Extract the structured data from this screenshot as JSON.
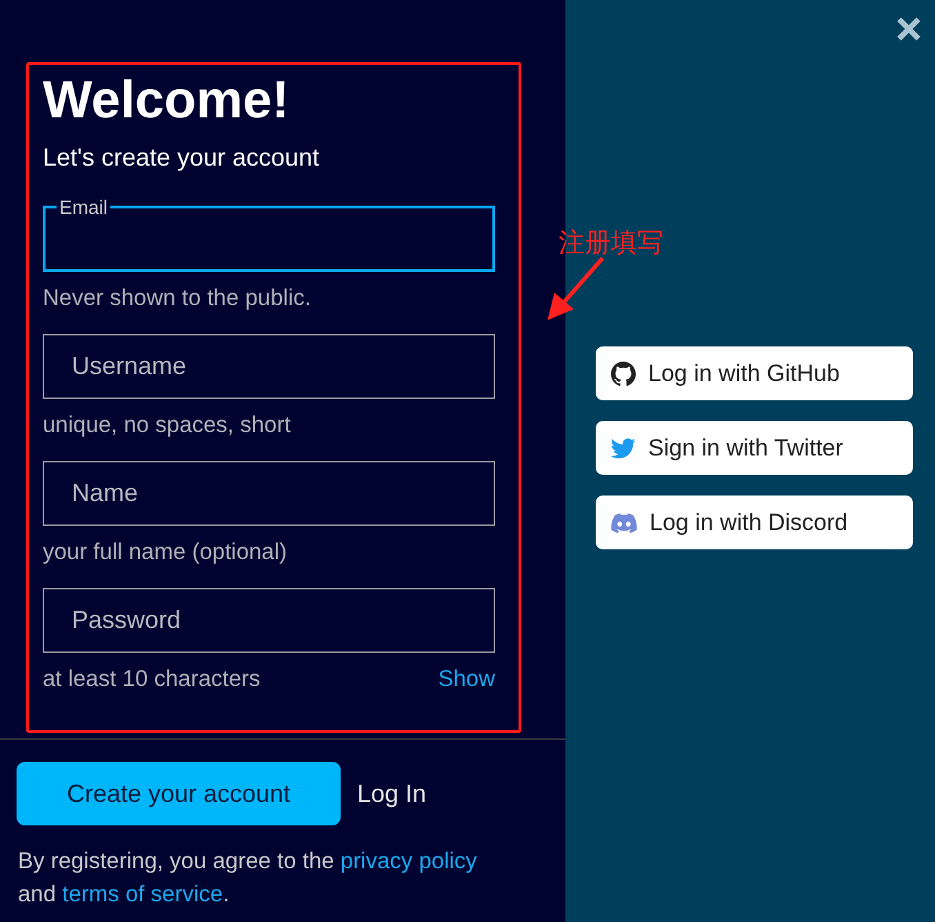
{
  "signup": {
    "title": "Welcome!",
    "subtitle": "Let's create your account",
    "fields": [
      {
        "kind": "floating",
        "label": "Email",
        "focused": true,
        "hint": "Never shown to the public."
      },
      {
        "kind": "plain",
        "placeholder": "Username",
        "focused": false,
        "hint": "unique, no spaces, short"
      },
      {
        "kind": "plain",
        "placeholder": "Name",
        "focused": false,
        "hint": "your full name (optional)"
      },
      {
        "kind": "plain",
        "placeholder": "Password",
        "focused": false,
        "hint": "at least 10 characters",
        "toggle": "Show"
      }
    ],
    "create_button": "Create your account",
    "login_link": "Log In",
    "legal": "By registering, you agree to the ",
    "privacy_link": "privacy policy",
    "legal_and": "and ",
    "terms_link": "terms of service",
    "legal_end": "."
  },
  "annotation": {
    "text": "注册填写"
  },
  "social_buttons": [
    {
      "kind": "github",
      "label": "Log in with GitHub"
    },
    {
      "kind": "twitter",
      "label": "Sign in with Twitter"
    },
    {
      "kind": "discord",
      "label": "Log in with Discord"
    }
  ]
}
